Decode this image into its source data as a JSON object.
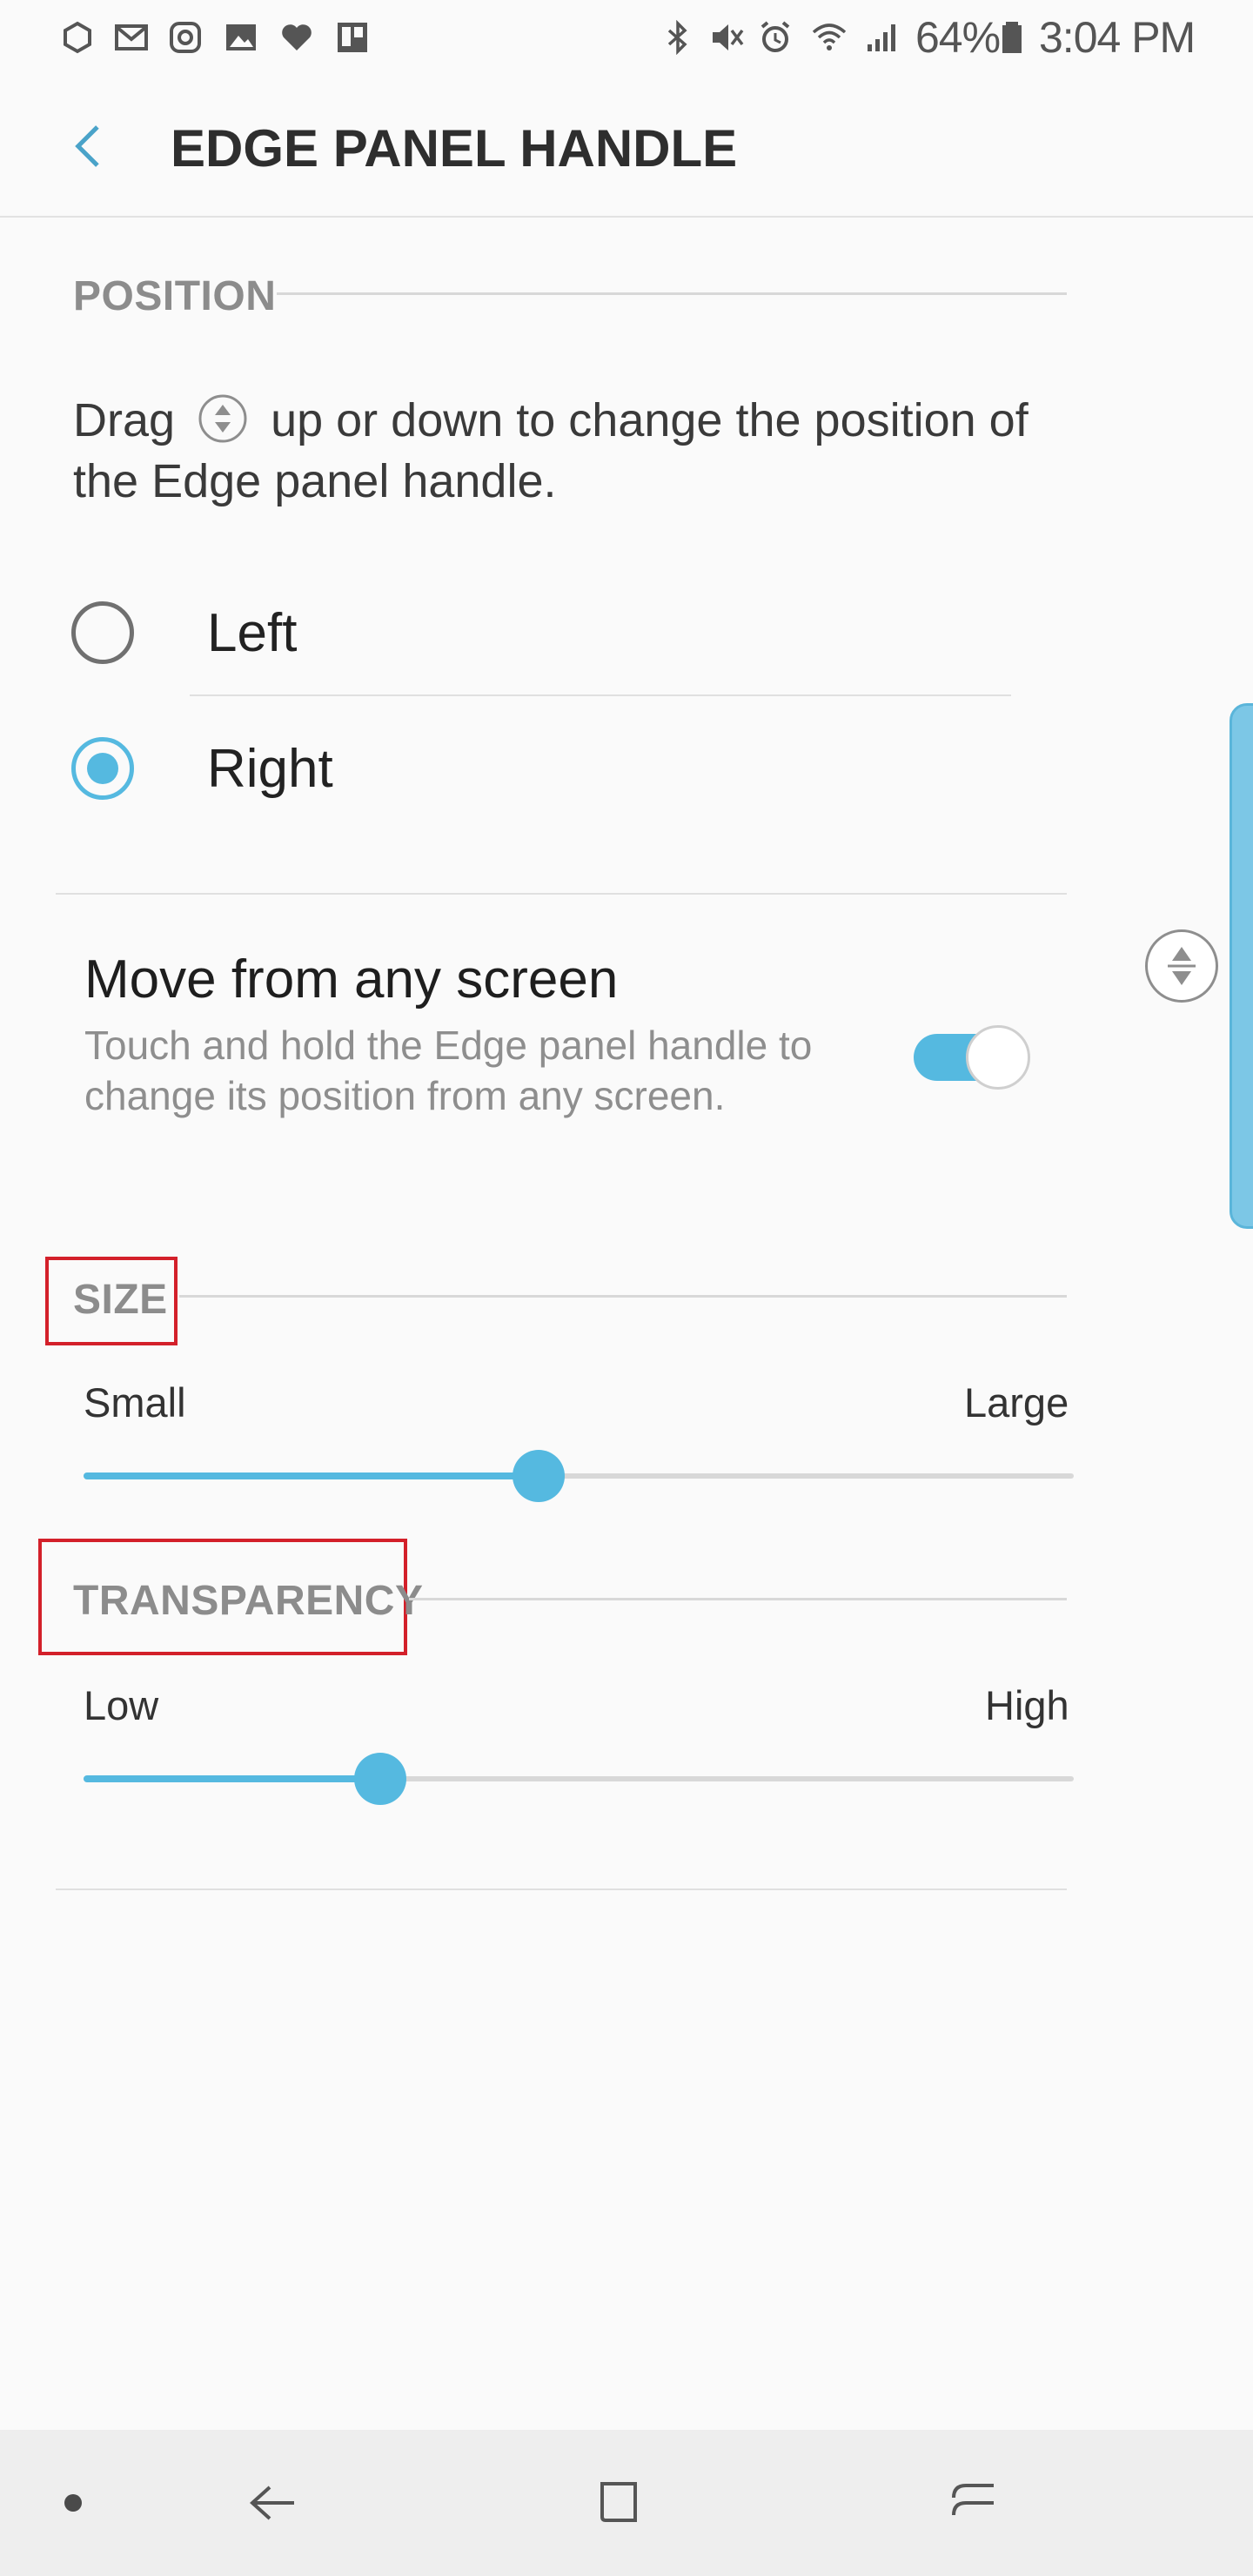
{
  "status_bar": {
    "battery": "64%",
    "time": "3:04 PM",
    "left_icons": [
      "app-icon",
      "gmail-icon",
      "instagram-icon",
      "gallery-icon",
      "heart-icon",
      "trello-icon"
    ],
    "right_icons": [
      "bluetooth-icon",
      "mute-icon",
      "alarm-icon",
      "wifi-icon",
      "signal-icon",
      "battery-icon"
    ]
  },
  "header": {
    "title": "EDGE PANEL HANDLE"
  },
  "position": {
    "label": "POSITION",
    "desc_before": "Drag",
    "desc_after": "up or down to change the position of the Edge panel handle.",
    "options": [
      {
        "label": "Left",
        "selected": false
      },
      {
        "label": "Right",
        "selected": true
      }
    ]
  },
  "move": {
    "title": "Move from any screen",
    "subtitle": "Touch and hold the Edge panel handle to change its position from any screen.",
    "enabled": true
  },
  "size": {
    "label": "SIZE",
    "min_label": "Small",
    "max_label": "Large",
    "value": 0.46
  },
  "transparency": {
    "label": "TRANSPARENCY",
    "min_label": "Low",
    "max_label": "High",
    "value": 0.3
  },
  "colors": {
    "accent": "#55b9e0",
    "highlight_box": "#d3202a"
  }
}
